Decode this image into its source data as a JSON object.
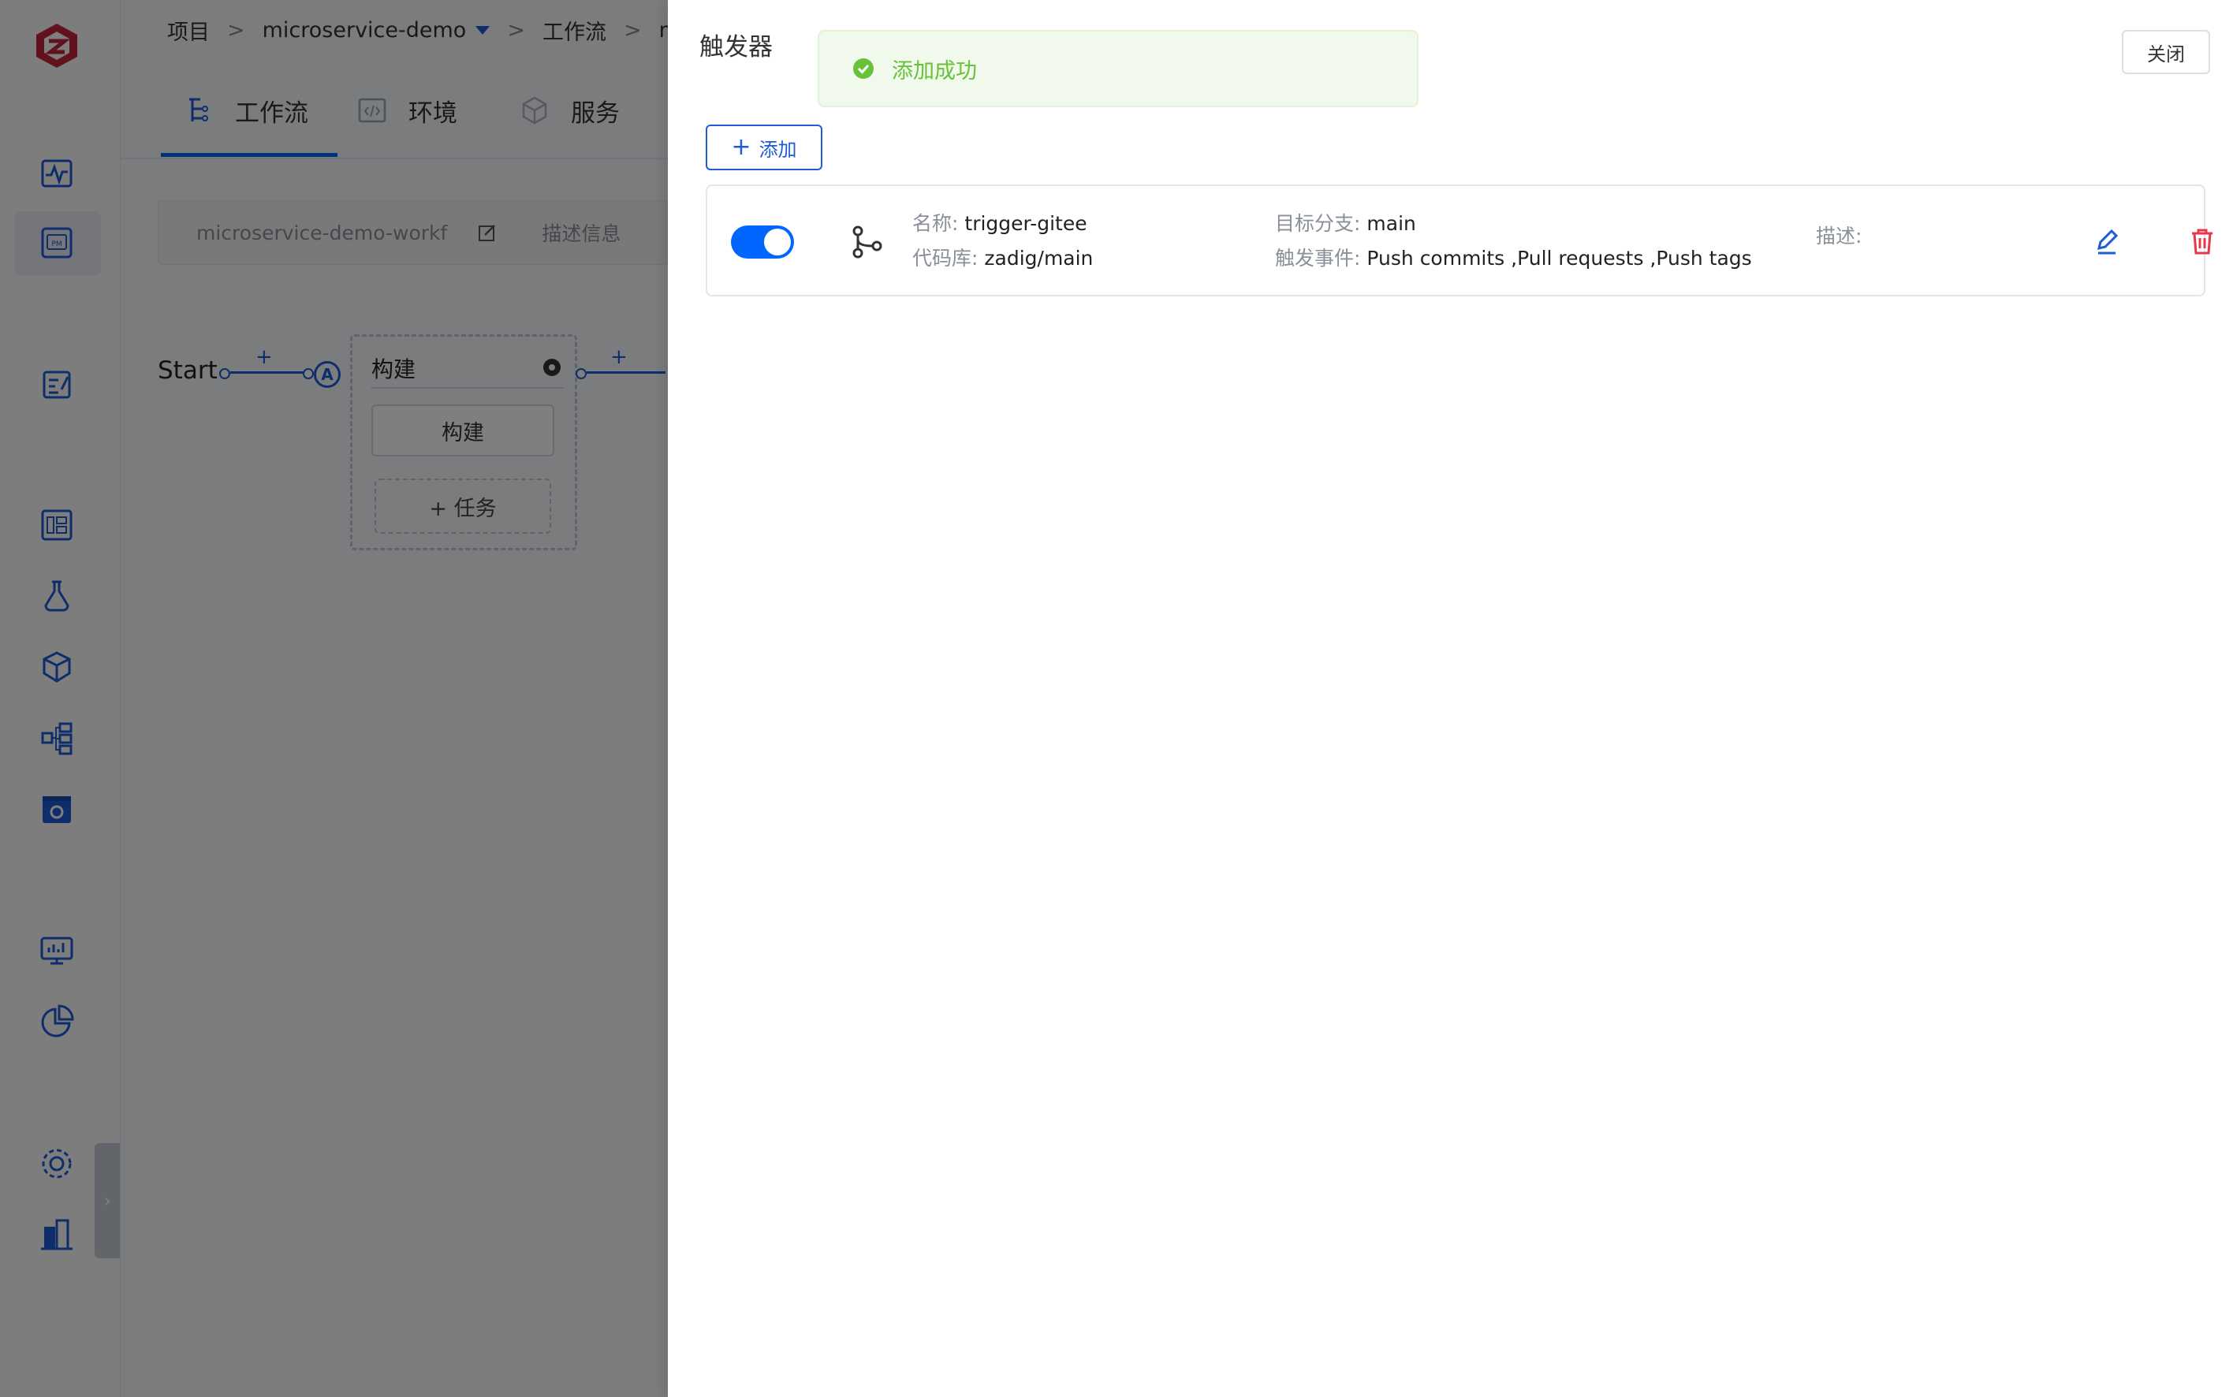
{
  "breadcrumb": {
    "project_label": "项目",
    "project_name": "microservice-demo",
    "workflow_label": "工作流",
    "workflow_name_truncated": "mic",
    "separator": ">"
  },
  "tabs": [
    {
      "label": "工作流",
      "active": true
    },
    {
      "label": "环境",
      "active": false
    },
    {
      "label": "服务",
      "active": false
    }
  ],
  "info_bar": {
    "workflow_name": "microservice-demo-workf",
    "description_placeholder": "描述信息"
  },
  "flow": {
    "start_label": "Start",
    "plus": "+",
    "node_a": "A",
    "stage_title": "构建",
    "job_label": "构建",
    "add_task_label": "+ 任务"
  },
  "drawer": {
    "title": "触发器",
    "close_label": "关闭",
    "add_label": "添加",
    "add_plus": "+"
  },
  "toast": {
    "message": "添加成功",
    "color": "#67c23a"
  },
  "trigger": {
    "enabled": true,
    "name_key": "名称:",
    "name_value": "trigger-gitee",
    "repo_key": "代码库:",
    "repo_value": "zadig/main",
    "branch_key": "目标分支:",
    "branch_value": "main",
    "events_key": "触发事件:",
    "events_value": "Push commits ,Pull requests ,Push tags",
    "desc_key": "描述:"
  },
  "colors": {
    "primary": "#0066ff",
    "danger": "#e8374b",
    "brand": "#c2243a"
  },
  "icons": {
    "logo": "zadig-logo-icon",
    "edit": "pencil-icon",
    "delete": "trash-icon",
    "branch": "git-branch-icon"
  }
}
